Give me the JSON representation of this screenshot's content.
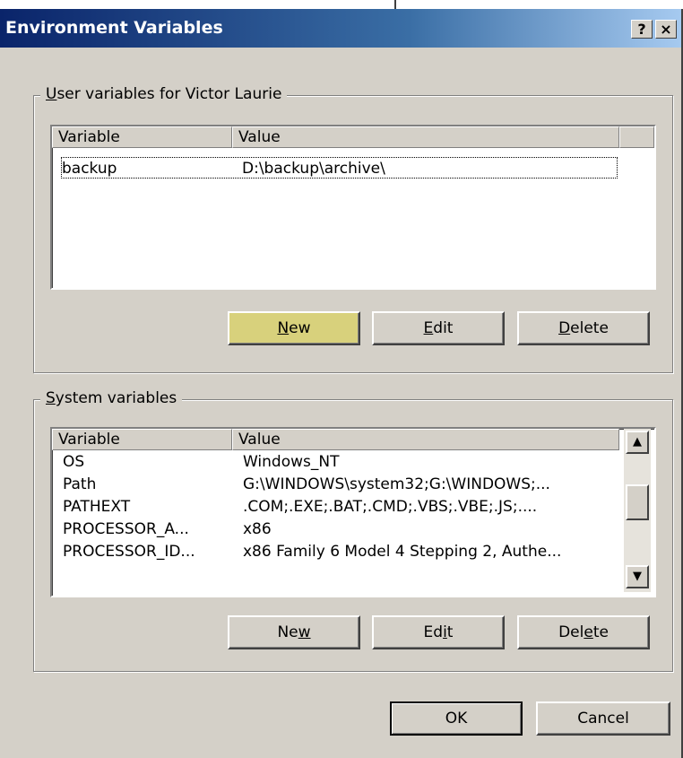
{
  "window": {
    "title": "Environment Variables",
    "help_glyph": "?",
    "close_glyph": "×"
  },
  "user_group": {
    "legend_prefix": "",
    "legend_u": "U",
    "legend_rest": "ser variables for Victor Laurie",
    "columns": [
      "Variable",
      "Value"
    ],
    "rows": [
      {
        "variable": "backup",
        "value": "D:\\backup\\archive\\"
      }
    ],
    "buttons": {
      "new": {
        "u": "N",
        "rest": "ew"
      },
      "edit": {
        "u": "E",
        "rest": "dit"
      },
      "delete": {
        "u": "D",
        "rest": "elete"
      }
    }
  },
  "system_group": {
    "legend_u": "S",
    "legend_rest": "ystem variables",
    "columns": [
      "Variable",
      "Value"
    ],
    "rows": [
      {
        "variable": "OS",
        "value": "Windows_NT"
      },
      {
        "variable": "Path",
        "value": "G:\\WINDOWS\\system32;G:\\WINDOWS;..."
      },
      {
        "variable": "PATHEXT",
        "value": ".COM;.EXE;.BAT;.CMD;.VBS;.VBE;.JS;...."
      },
      {
        "variable": "PROCESSOR_A...",
        "value": "x86"
      },
      {
        "variable": "PROCESSOR_ID...",
        "value": "x86 Family 6 Model 4 Stepping 2, Authe..."
      }
    ],
    "buttons": {
      "new": {
        "pre": "Ne",
        "u": "w",
        "rest": ""
      },
      "edit": {
        "pre": "Ed",
        "u": "i",
        "rest": "t"
      },
      "delete": {
        "pre": "Del",
        "u": "e",
        "rest": "te"
      }
    },
    "scroll_up_glyph": "▲",
    "scroll_down_glyph": "▼"
  },
  "footer": {
    "ok_label": "OK",
    "cancel_label": "Cancel"
  }
}
